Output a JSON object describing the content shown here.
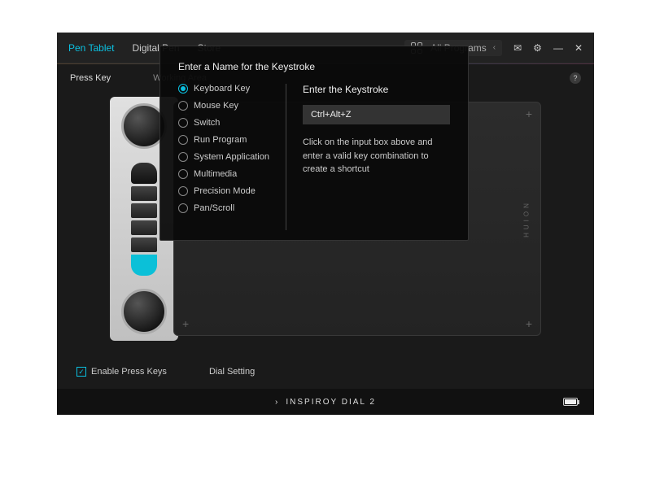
{
  "tabs": {
    "pen_tablet": "Pen Tablet",
    "digital_pen": "Digital Pen",
    "store": "Store"
  },
  "program_selector": "All Programs",
  "subtabs": {
    "press_key": "Press Key",
    "working_area": "Working Area"
  },
  "dialog": {
    "title": "Enter a Name for the Keystroke",
    "options": [
      "Keyboard Key",
      "Mouse Key",
      "Switch",
      "Run Program",
      "System Application",
      "Multimedia",
      "Precision Mode",
      "Pan/Scroll"
    ],
    "right_title": "Enter the Keystroke",
    "input_value": "Ctrl+Alt+Z",
    "hint": "Click on the input box above and enter a valid key combination to create a shortcut"
  },
  "bottom": {
    "enable_press_keys": "Enable Press Keys",
    "dial_setting": "Dial Setting"
  },
  "device": "INSPIROY DIAL 2",
  "brand": "HUION"
}
